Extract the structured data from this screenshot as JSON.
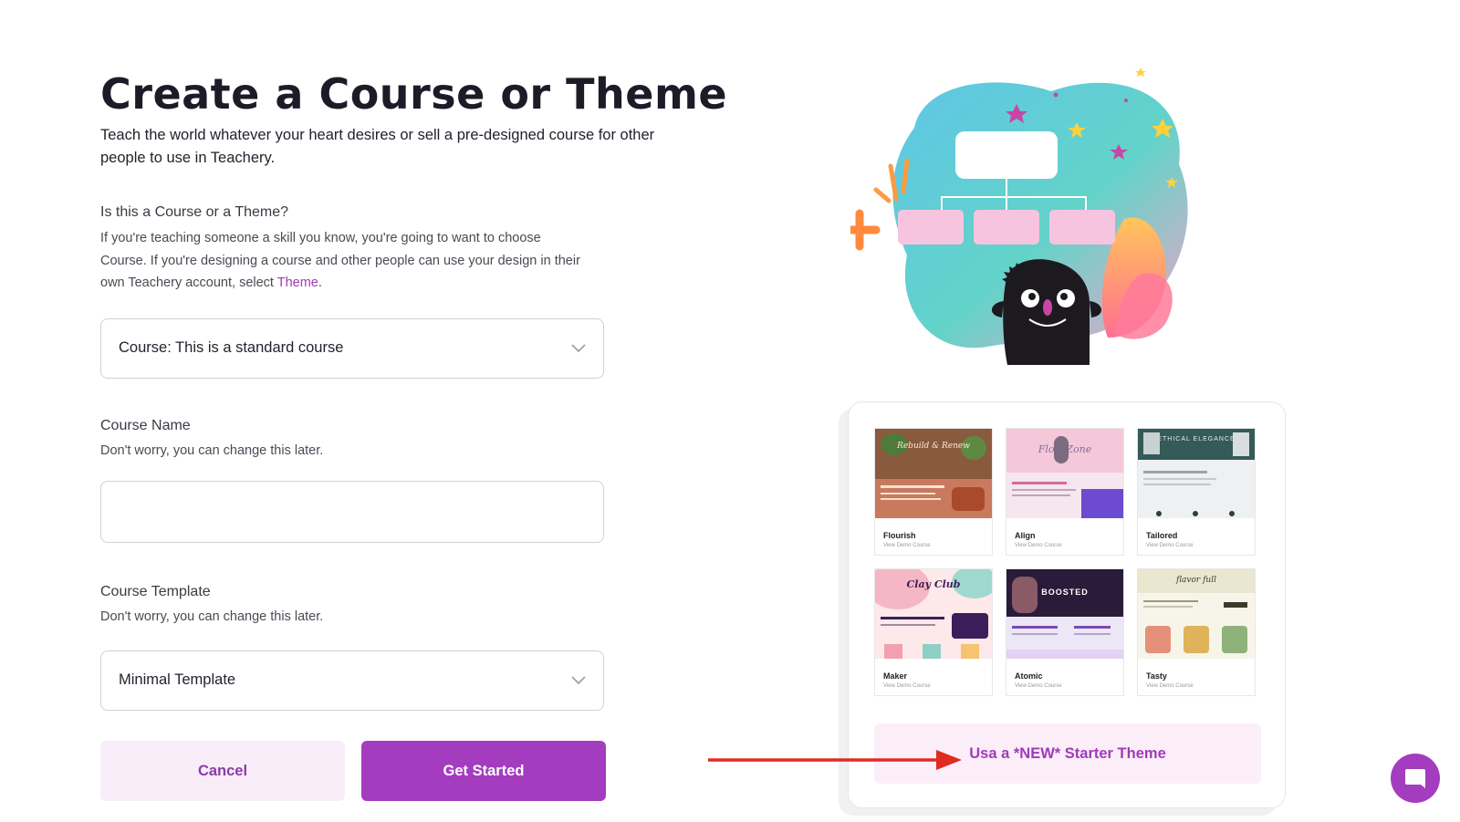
{
  "header": {
    "title": "Create a Course or Theme",
    "subtitle": "Teach the world whatever your heart desires or sell a pre-designed course for other people to use in Teachery."
  },
  "type_section": {
    "label": "Is this a Course or a Theme?",
    "description_before": "If you're teaching someone a skill you know, you're going to want to choose Course. If you're designing a course and other people can use your design in their own Teachery account, select ",
    "description_link": "Theme",
    "description_after": ".",
    "selected": "Course: This is a standard course"
  },
  "course_name": {
    "label": "Course Name",
    "hint": "Don't worry, you can change this later.",
    "value": ""
  },
  "course_template": {
    "label": "Course Template",
    "hint": "Don't worry, you can change this later.",
    "selected": "Minimal Template"
  },
  "buttons": {
    "cancel": "Cancel",
    "get_started": "Get Started"
  },
  "themes": [
    {
      "name": "Flourish",
      "link": "View Demo Course",
      "thumb_text": "Rebuild & Renew"
    },
    {
      "name": "Align",
      "link": "View Demo Course",
      "thumb_text": "Flow Zone"
    },
    {
      "name": "Tailored",
      "link": "View Demo Course",
      "thumb_text": "ETHICAL ELEGANCE"
    },
    {
      "name": "Maker",
      "link": "View Demo Course",
      "thumb_text": "Clay Club"
    },
    {
      "name": "Atomic",
      "link": "View Demo Course",
      "thumb_text": "BOOSTED"
    },
    {
      "name": "Tasty",
      "link": "View Demo Course",
      "thumb_text": "flavor full"
    }
  ],
  "starter_theme_button": "Usa a *NEW* Starter Theme",
  "colors": {
    "accent": "#a43cbf",
    "accent_light": "#f8edf8",
    "annotation_arrow": "#e02b20"
  },
  "icons": {
    "dropdown": "chevron-down-icon",
    "chat": "chat-bubble-icon"
  }
}
